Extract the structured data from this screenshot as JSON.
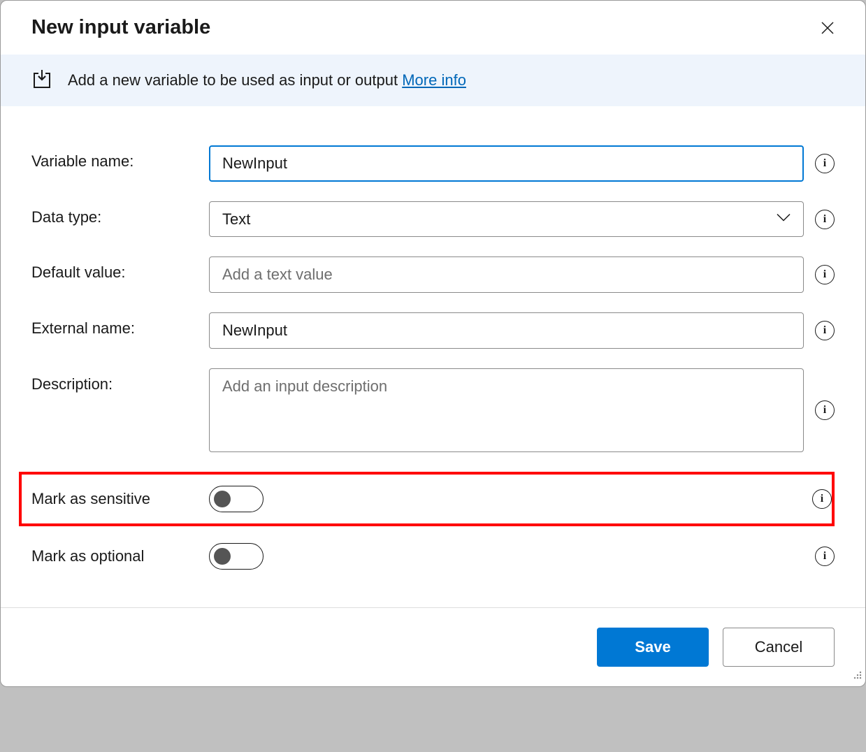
{
  "dialog": {
    "title": "New input variable"
  },
  "banner": {
    "text": "Add a new variable to be used as input or output ",
    "link": "More info"
  },
  "form": {
    "variable_name": {
      "label": "Variable name:",
      "value": "NewInput"
    },
    "data_type": {
      "label": "Data type:",
      "value": "Text"
    },
    "default_value": {
      "label": "Default value:",
      "placeholder": "Add a text value",
      "value": ""
    },
    "external_name": {
      "label": "External name:",
      "value": "NewInput"
    },
    "description": {
      "label": "Description:",
      "placeholder": "Add an input description",
      "value": ""
    },
    "mark_sensitive": {
      "label": "Mark as sensitive",
      "value": false
    },
    "mark_optional": {
      "label": "Mark as optional",
      "value": false
    }
  },
  "footer": {
    "save": "Save",
    "cancel": "Cancel"
  },
  "icons": {
    "info": "i"
  }
}
